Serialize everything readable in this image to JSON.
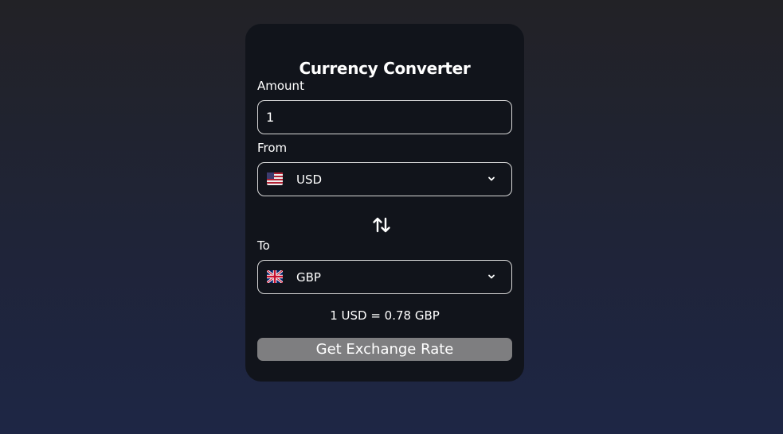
{
  "converter": {
    "title": "Currency Converter",
    "amount_label": "Amount",
    "amount_value": "1",
    "from_label": "From",
    "from_currency": "USD",
    "from_flag": "us-flag-icon",
    "to_label": "To",
    "to_currency": "GBP",
    "to_flag": "gb-flag-icon",
    "rate_text": "1 USD = 0.78 GBP",
    "button_label": "Get Exchange Rate"
  },
  "colors": {
    "card_background": "#11141b",
    "button_background": "#7e7e80",
    "border": "#d8d8d8",
    "text": "#ffffff"
  }
}
